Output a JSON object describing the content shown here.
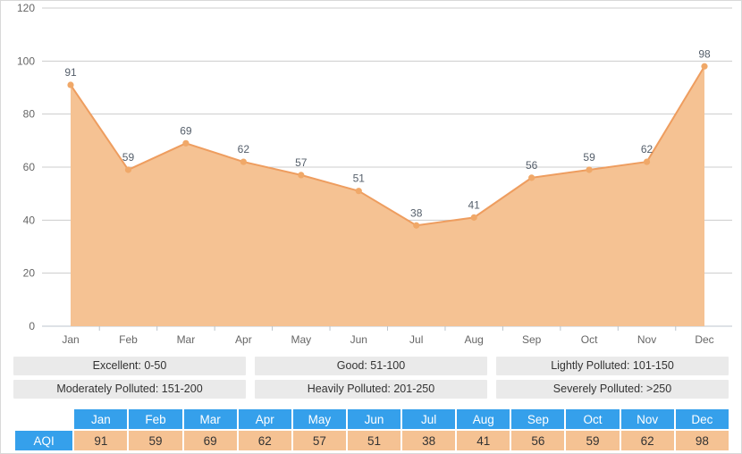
{
  "chart_data": {
    "type": "area",
    "title": "",
    "xlabel": "",
    "ylabel": "",
    "categories": [
      "Jan",
      "Feb",
      "Mar",
      "Apr",
      "May",
      "Jun",
      "Jul",
      "Aug",
      "Sep",
      "Oct",
      "Nov",
      "Dec"
    ],
    "series": [
      {
        "name": "AQI",
        "values": [
          91,
          59,
          69,
          62,
          57,
          51,
          38,
          41,
          56,
          59,
          62,
          98
        ]
      }
    ],
    "yticks": [
      0,
      20,
      40,
      60,
      80,
      100,
      120
    ],
    "ylim": [
      0,
      120
    ],
    "grid": true,
    "legend_position": "none",
    "show_data_labels": true,
    "colors": {
      "area_fill": "#f5c293",
      "line": "#ee9d5f",
      "marker": "#f0a868",
      "gridline": "#cccccc",
      "axis_text": "#666666"
    }
  },
  "legend": {
    "items": [
      {
        "label": "Excellent: 0-50"
      },
      {
        "label": "Good: 51-100"
      },
      {
        "label": "Lightly Polluted: 101-150"
      },
      {
        "label": "Moderately Polluted: 151-200"
      },
      {
        "label": "Heavily Polluted: 201-250"
      },
      {
        "label": "Severely Polluted: >250"
      }
    ]
  },
  "table": {
    "row_label": "AQI",
    "headers": [
      "Jan",
      "Feb",
      "Mar",
      "Apr",
      "May",
      "Jun",
      "Jul",
      "Aug",
      "Sep",
      "Oct",
      "Nov",
      "Dec"
    ],
    "values": [
      "91",
      "59",
      "69",
      "62",
      "57",
      "51",
      "38",
      "41",
      "56",
      "59",
      "62",
      "98"
    ]
  },
  "theme": {
    "header_blue": "#35a0eb",
    "cell_orange": "#f5c293",
    "legend_gray": "#eaeaea"
  }
}
